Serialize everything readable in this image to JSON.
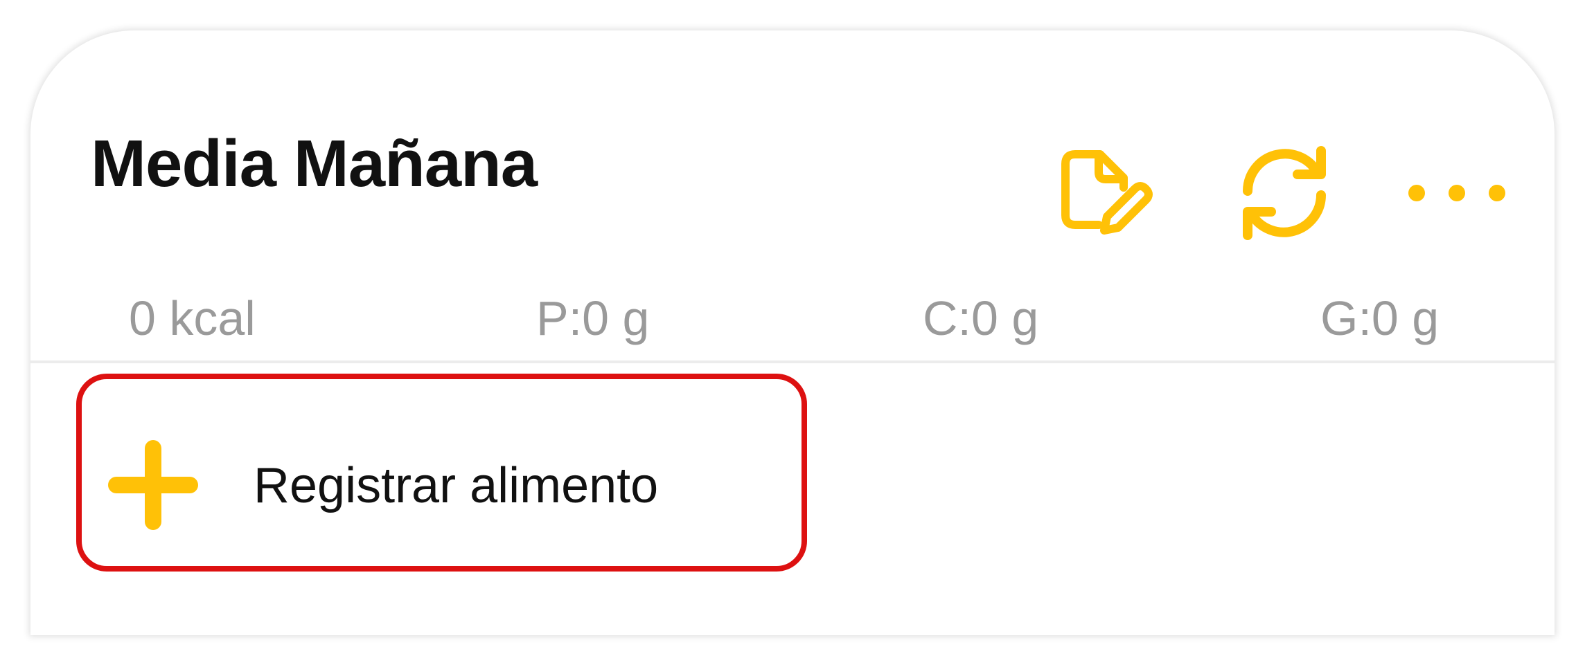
{
  "meal": {
    "title": "Media Mañana"
  },
  "actions": {
    "edit_icon": "edit-note-icon",
    "sync_icon": "sync-icon",
    "more_icon": "more-options-icon"
  },
  "nutrition": {
    "calories": "0 kcal",
    "protein": "P:0 g",
    "carbs": "C:0 g",
    "fat": "G:0 g"
  },
  "add_food": {
    "label": "Registrar alimento",
    "icon": "plus-icon"
  },
  "colors": {
    "accent": "#FFC107",
    "highlight_border": "#DD1111",
    "muted_text": "#9A9A9A"
  }
}
